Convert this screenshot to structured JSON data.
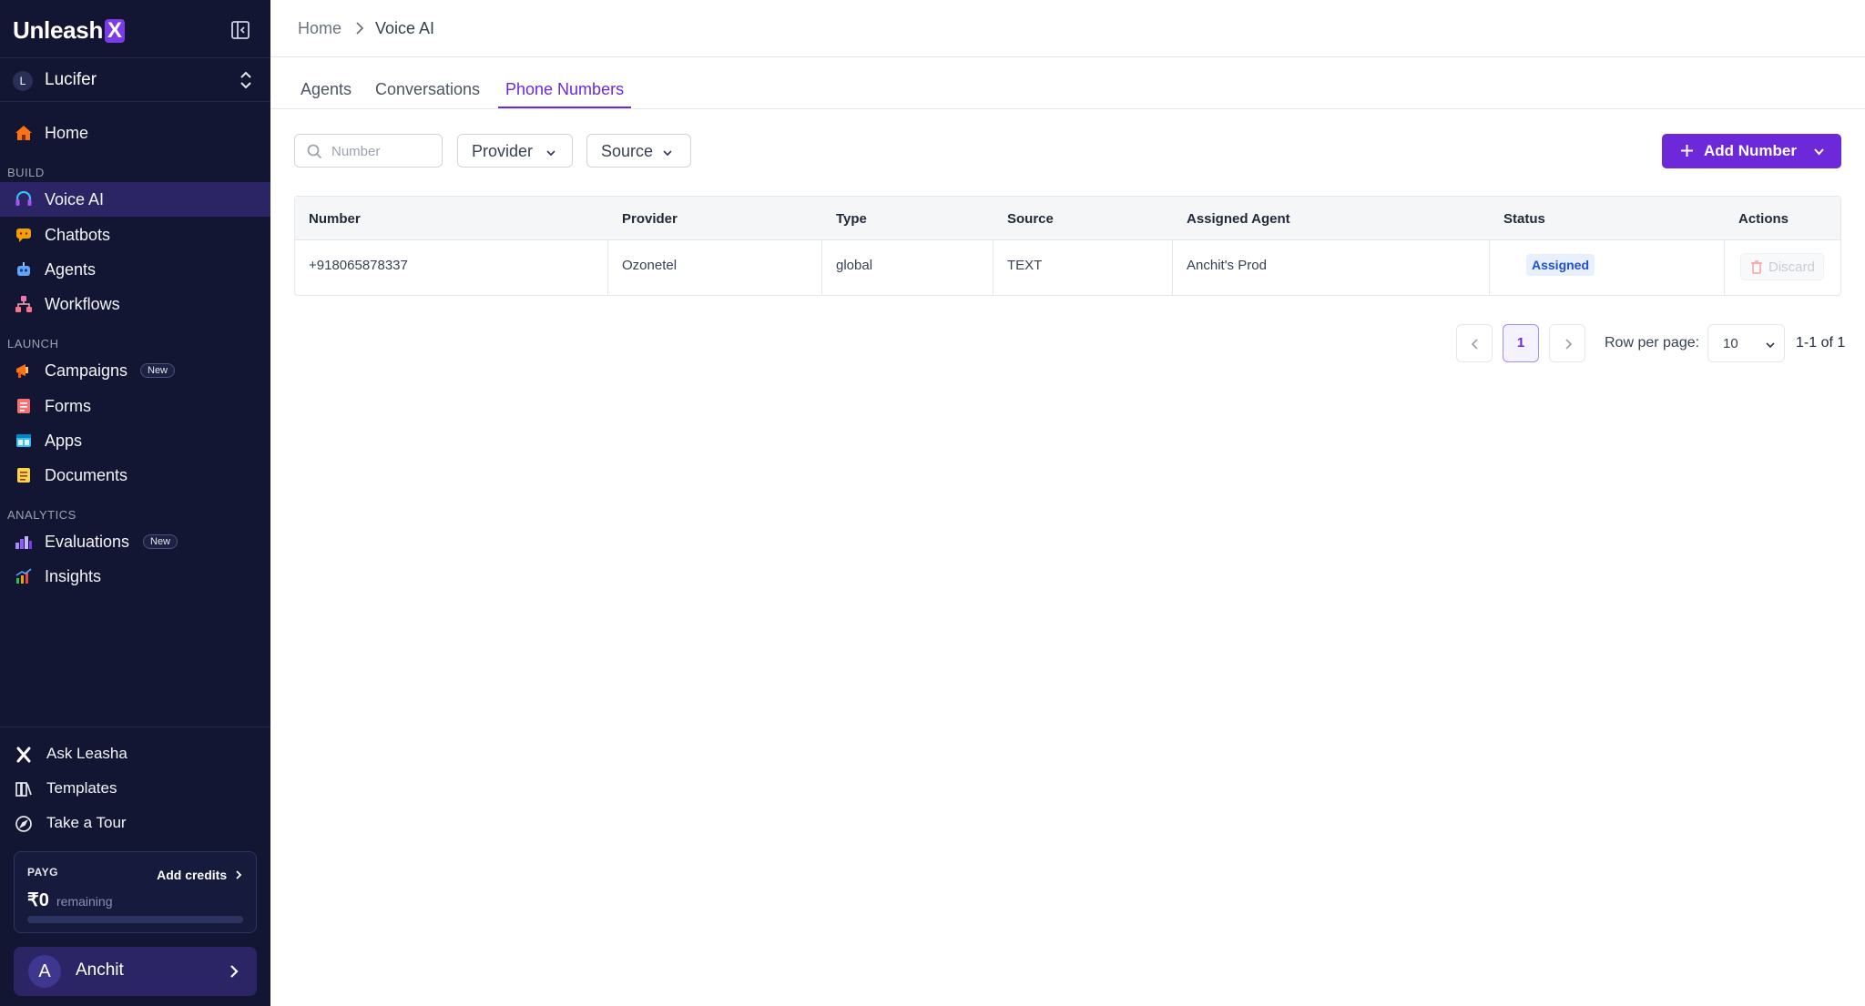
{
  "app": {
    "logo_text": "Unleash",
    "logo_mark": "X"
  },
  "org": {
    "initial": "L",
    "name": "Lucifer"
  },
  "sidebar": {
    "home": "Home",
    "sections": {
      "build": "BUILD",
      "launch": "LAUNCH",
      "analytics": "ANALYTICS"
    },
    "build_items": [
      {
        "label": "Voice AI",
        "icon": "headset-icon",
        "active": true
      },
      {
        "label": "Chatbots",
        "icon": "chat-bubble-icon"
      },
      {
        "label": "Agents",
        "icon": "robot-icon"
      },
      {
        "label": "Workflows",
        "icon": "workflow-icon"
      }
    ],
    "launch_items": [
      {
        "label": "Campaigns",
        "icon": "megaphone-icon",
        "badge": "New"
      },
      {
        "label": "Forms",
        "icon": "form-icon"
      },
      {
        "label": "Apps",
        "icon": "apps-icon"
      },
      {
        "label": "Documents",
        "icon": "document-icon"
      }
    ],
    "analytics_items": [
      {
        "label": "Evaluations",
        "icon": "bar-chart-icon",
        "badge": "New"
      },
      {
        "label": "Insights",
        "icon": "insights-icon"
      }
    ],
    "footer_items": [
      {
        "label": "Ask Leasha",
        "icon": "x-logo-icon"
      },
      {
        "label": "Templates",
        "icon": "templates-icon"
      },
      {
        "label": "Take a Tour",
        "icon": "compass-icon"
      }
    ]
  },
  "credits": {
    "plan": "PAYG",
    "add_label": "Add credits",
    "amount": "₹0",
    "remaining_label": "remaining",
    "used_fraction": 0
  },
  "user": {
    "initial": "A",
    "name": "Anchit"
  },
  "breadcrumb": {
    "home": "Home",
    "current": "Voice AI"
  },
  "tabs": [
    {
      "label": "Agents"
    },
    {
      "label": "Conversations"
    },
    {
      "label": "Phone Numbers",
      "active": true
    }
  ],
  "filters": {
    "search_placeholder": "Number",
    "search_value": "",
    "provider": "Provider",
    "source": "Source"
  },
  "add_button": {
    "label": "Add Number"
  },
  "table": {
    "headers": [
      "Number",
      "Provider",
      "Type",
      "Source",
      "Assigned Agent",
      "Status",
      "Actions"
    ],
    "rows": [
      {
        "number": "+918065878337",
        "provider": "Ozonetel",
        "type": "global",
        "source": "TEXT",
        "agent": "Anchit's Prod",
        "status": "Assigned",
        "action": "Discard"
      }
    ]
  },
  "pagination": {
    "current_page": "1",
    "rows_per_page_label": "Row per page:",
    "rows_per_page": "10",
    "range": "1-1 of 1"
  },
  "colors": {
    "sidebar_bg": "#121633",
    "active_nav": "#2b2566",
    "accent": "#6d28d9",
    "status_badge": "#1d4ed8"
  }
}
